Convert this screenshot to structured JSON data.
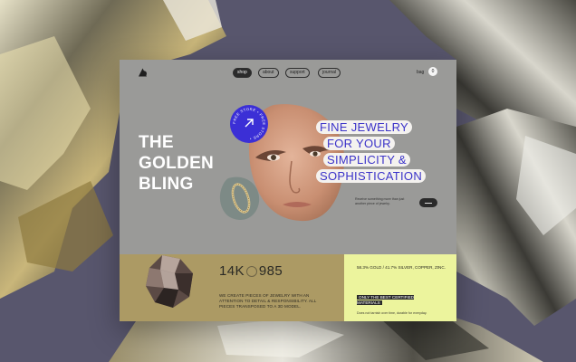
{
  "nav": {
    "links": [
      "shop",
      "about",
      "support",
      "journal"
    ],
    "active": "shop",
    "bag_label": "bag",
    "bag_count": "0"
  },
  "hero": {
    "title_lines": [
      "THE",
      "GOLDEN",
      "BLING"
    ],
    "headline_lines": [
      "FINE JEWELRY",
      "FOR YOUR",
      "SIMPLICITY &",
      "SOPHISTICATION"
    ],
    "badge_text": "FREE STORE • FREE STORE •",
    "small_description": "Receive something more than just another piece of jewelry."
  },
  "stats": {
    "left": "14K",
    "right": "985",
    "description": "WE CREATE PIECES OF JEWELRY WITH AN ATTENTION TO DETAIL & RESPONSIBILITY. ALL PIECES TRANSPOSED TO A 3D MODEL."
  },
  "materials": {
    "text": "58.3% GOLD / 41.7% SILVER, COPPER, ZINC.",
    "certified": "ONLY THE BEST CERTIFIED MATERIALS",
    "footnote": "Does not tarnish over time, durable for everyday."
  },
  "colors": {
    "background": "#58566d",
    "card": "#9a9a98",
    "accent_blue": "#3b2fd6",
    "gold_panel": "#ac9a64",
    "yellow_panel": "#ecf49d"
  }
}
